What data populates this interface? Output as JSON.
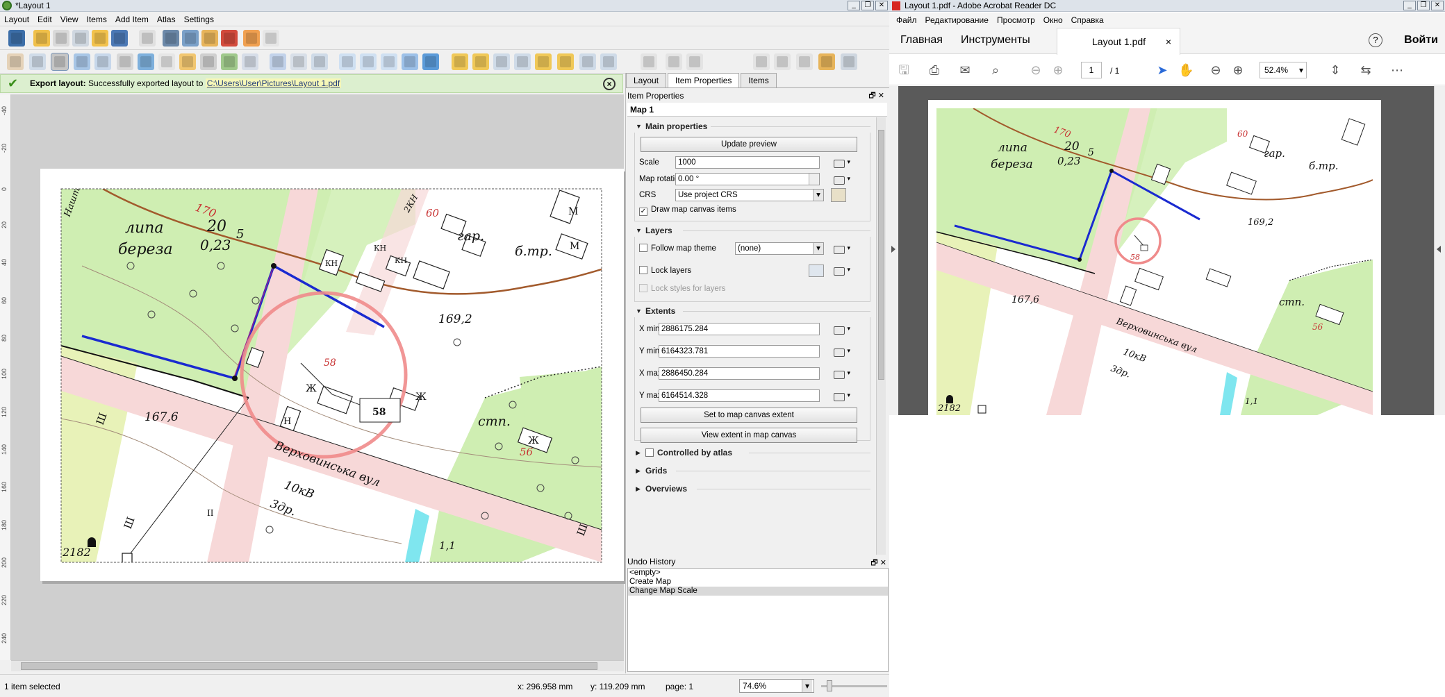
{
  "qgis": {
    "title": "*Layout 1",
    "menu": [
      "Layout",
      "Edit",
      "View",
      "Items",
      "Add Item",
      "Atlas",
      "Settings"
    ],
    "message": {
      "title": "Export layout:",
      "text": "Successfully exported layout to",
      "link": "C:\\Users\\User\\Pictures\\Layout 1.pdf"
    },
    "atlas_page": "1",
    "ruler_labels": [
      "-40",
      "-20",
      "0",
      "20",
      "40",
      "60",
      "80",
      "100",
      "120",
      "140",
      "160",
      "180",
      "200",
      "220",
      "240"
    ],
    "panel": {
      "tabs": [
        "Layout",
        "Item Properties",
        "Items"
      ],
      "header": "Item Properties",
      "item_title": "Map 1",
      "main_properties": "Main properties",
      "update_preview": "Update preview",
      "scale_label": "Scale",
      "scale_value": "1000",
      "rotation_label": "Map rotation",
      "rotation_value": "0.00 °",
      "crs_label": "CRS",
      "crs_value": "Use project CRS",
      "draw_items": "Draw map canvas items",
      "layers": "Layers",
      "follow_theme": "Follow map theme",
      "theme_value": "(none)",
      "lock_layers": "Lock layers",
      "lock_styles": "Lock styles for layers",
      "extents": "Extents",
      "xmin_label": "X min",
      "xmin": "2886175.284",
      "ymin_label": "Y min",
      "ymin": "6164323.781",
      "xmax_label": "X max",
      "xmax": "2886450.284",
      "ymax_label": "Y max",
      "ymax": "6164514.328",
      "set_extent": "Set to map canvas extent",
      "view_extent": "View extent in map canvas",
      "controlled_atlas": "Controlled by atlas",
      "grids": "Grids",
      "overviews": "Overviews"
    },
    "undo": {
      "title": "Undo History",
      "items": [
        "<empty>",
        "Create Map",
        "Change Map Scale"
      ]
    },
    "status": {
      "selected": "1 item selected",
      "x": "x: 296.958 mm",
      "y": "y: 119.209 mm",
      "page": "page: 1",
      "zoom": "74.6%"
    }
  },
  "map": {
    "labels": {
      "lipa": "липа",
      "bereza": "береза",
      "n20": "20",
      "n023": "0,23",
      "n5": "5",
      "n170": "170",
      "n60": "60",
      "gar": "гар.",
      "btr": "б.тр.",
      "h1692": "169,2",
      "h1676": "167,6",
      "stp": "стп.",
      "n56": "56",
      "n58": "58",
      "n58label": "58",
      "street": "Верховинська вул",
      "kv": "10кВ",
      "zdr": "3др.",
      "n11": "1,1",
      "n2182": "2182",
      "nasht": "Нашта",
      "kh": "КН",
      "zh": "Ж",
      "n": "Н",
      "m": "М",
      "sh": "Ш",
      "ii": "II",
      "n2n": "2КН"
    }
  },
  "acrobat": {
    "title": "Layout 1.pdf - Adobe Acrobat Reader DC",
    "menu": [
      "Файл",
      "Редактирование",
      "Просмотр",
      "Окно",
      "Справка"
    ],
    "home": "Главная",
    "tools": "Инструменты",
    "doc_tab": "Layout 1.pdf",
    "login": "Войти",
    "page_current": "1",
    "page_total": "/ 1",
    "zoom": "52.4%",
    "labels": {
      "n170": "170",
      "n60": "60",
      "lipa": "липа",
      "bereza": "береза",
      "n20": "20",
      "n023": "0,23",
      "n5": "5",
      "gar": "гар.",
      "btr": "б.тр.",
      "h1692": "169,2",
      "h1676": "167,6",
      "stp": "стп.",
      "n56": "56",
      "n58": "58",
      "street": "Верховинська вул",
      "kv": "10кВ",
      "zdr": "3др.",
      "n11": "1,1",
      "n2182": "2182"
    }
  }
}
